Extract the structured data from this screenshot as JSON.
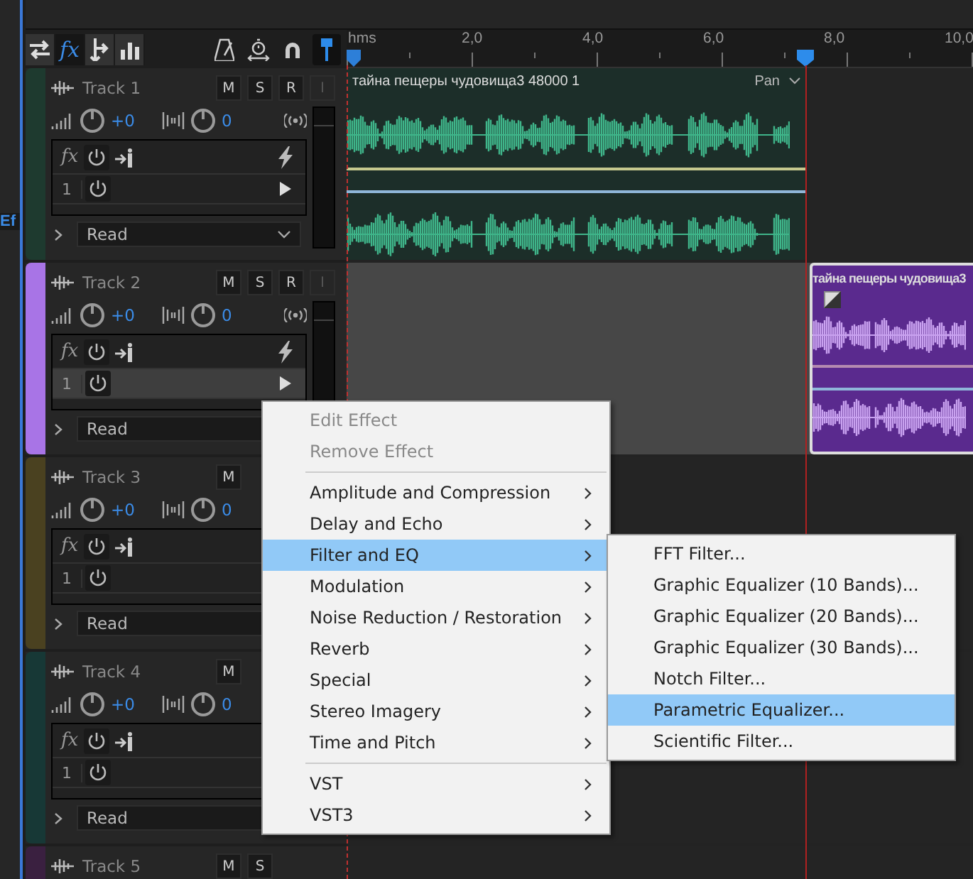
{
  "left_panel": {
    "tab": "Ef"
  },
  "toolbar": {
    "views": [
      {
        "selected": false
      },
      {
        "label": "fx",
        "selected": true
      },
      {
        "selected": false
      },
      {
        "selected": false
      }
    ],
    "tools": [
      {
        "selected": false
      },
      {
        "selected": false
      },
      {
        "selected": false
      },
      {
        "selected": true
      }
    ]
  },
  "ruler": {
    "labels": [
      "hms",
      "2,0",
      "4,0",
      "6,0",
      "8,0",
      "10,0"
    ]
  },
  "tracks": [
    {
      "name": "Track 1",
      "color": "#1e3a2f",
      "buttons": [
        {
          "label": "M",
          "disabled": false
        },
        {
          "label": "S",
          "disabled": false
        },
        {
          "label": "R",
          "disabled": false
        },
        {
          "label": "I",
          "disabled": true
        }
      ],
      "volume": "+0",
      "pan": "0",
      "rack_label": "fx",
      "slots": [
        {
          "number": "1",
          "selected": false
        }
      ],
      "automation": "Read",
      "clip": {
        "name": "тайна пещеры чудовища3 48000 1",
        "tag": "Pan",
        "kind": "green"
      }
    },
    {
      "name": "Track 2",
      "color": "#a874e6",
      "buttons": [
        {
          "label": "M",
          "disabled": false
        },
        {
          "label": "S",
          "disabled": false
        },
        {
          "label": "R",
          "disabled": false
        },
        {
          "label": "I",
          "disabled": true
        }
      ],
      "volume": "+0",
      "pan": "0",
      "rack_label": "fx",
      "slots": [
        {
          "number": "1",
          "selected": true
        }
      ],
      "automation": "Read",
      "clip": {
        "name": "тайна пещеры чудовища3",
        "kind": "purple"
      }
    },
    {
      "name": "Track 3",
      "color": "#4a4120",
      "buttons": [
        {
          "label": "M",
          "disabled": false
        }
      ],
      "volume": "+0",
      "pan": "0",
      "rack_label": "fx",
      "slots": [
        {
          "number": "1",
          "selected": false
        }
      ],
      "automation": "Read"
    },
    {
      "name": "Track 4",
      "color": "#173836",
      "buttons": [
        {
          "label": "M",
          "disabled": false
        }
      ],
      "volume": "+0",
      "pan": "0",
      "rack_label": "fx",
      "slots": [
        {
          "number": "1",
          "selected": false
        }
      ],
      "automation": "Read"
    },
    {
      "name": "Track 5",
      "color": "#3a2040",
      "buttons": [
        {
          "label": "M",
          "disabled": false
        },
        {
          "label": "S",
          "disabled": false
        }
      ]
    }
  ],
  "context_menu": {
    "groups": [
      [
        {
          "label": "Edit Effect",
          "disabled": true,
          "has_submenu": false,
          "selected": false
        },
        {
          "label": "Remove Effect",
          "disabled": true,
          "has_submenu": false,
          "selected": false
        }
      ],
      [
        {
          "label": "Amplitude and Compression",
          "disabled": false,
          "has_submenu": true,
          "selected": false
        },
        {
          "label": "Delay and Echo",
          "disabled": false,
          "has_submenu": true,
          "selected": false
        },
        {
          "label": "Filter and EQ",
          "disabled": false,
          "has_submenu": true,
          "selected": true
        },
        {
          "label": "Modulation",
          "disabled": false,
          "has_submenu": true,
          "selected": false
        },
        {
          "label": "Noise Reduction / Restoration",
          "disabled": false,
          "has_submenu": true,
          "selected": false
        },
        {
          "label": "Reverb",
          "disabled": false,
          "has_submenu": true,
          "selected": false
        },
        {
          "label": "Special",
          "disabled": false,
          "has_submenu": true,
          "selected": false
        },
        {
          "label": "Stereo Imagery",
          "disabled": false,
          "has_submenu": true,
          "selected": false
        },
        {
          "label": "Time and Pitch",
          "disabled": false,
          "has_submenu": true,
          "selected": false
        }
      ],
      [
        {
          "label": "VST",
          "disabled": false,
          "has_submenu": true,
          "selected": false
        },
        {
          "label": "VST3",
          "disabled": false,
          "has_submenu": true,
          "selected": false
        }
      ]
    ]
  },
  "submenu": {
    "items": [
      {
        "label": "FFT Filter...",
        "selected": false
      },
      {
        "label": "Graphic Equalizer (10 Bands)...",
        "selected": false
      },
      {
        "label": "Graphic Equalizer (20 Bands)...",
        "selected": false
      },
      {
        "label": "Graphic Equalizer (30 Bands)...",
        "selected": false
      },
      {
        "label": "Notch Filter...",
        "selected": false
      },
      {
        "label": "Parametric Equalizer...",
        "selected": true
      },
      {
        "label": "Scientific Filter...",
        "selected": false
      }
    ]
  }
}
